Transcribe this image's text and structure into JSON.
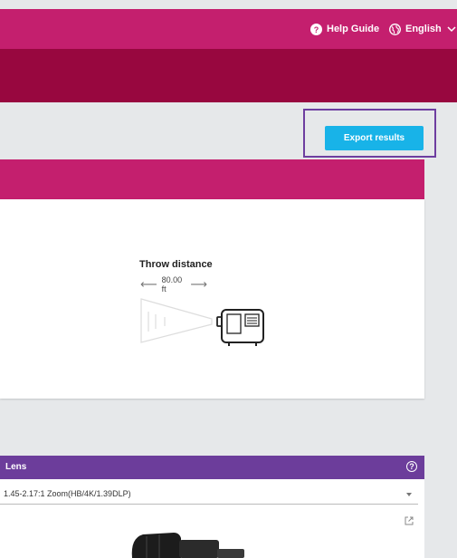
{
  "header": {
    "help_label": "Help Guide",
    "language_label": "English"
  },
  "toolbar": {
    "export_label": "Export results"
  },
  "throw": {
    "title": "Throw distance",
    "distance": "80.00 ft"
  },
  "lens": {
    "title": "Lens",
    "help_symbol": "?",
    "selected": "1.45-2.17:1 Zoom(HB/4K/1.39DLP)"
  },
  "colors": {
    "brand_magenta": "#c41f6e",
    "brand_dark": "#98073f",
    "accent_blue": "#18b3e8",
    "lens_purple": "#6c3d9b"
  },
  "icons": [
    "help-icon",
    "globe-icon",
    "chevron-down-icon",
    "arrow-left-icon",
    "arrow-right-icon",
    "external-link-icon"
  ]
}
